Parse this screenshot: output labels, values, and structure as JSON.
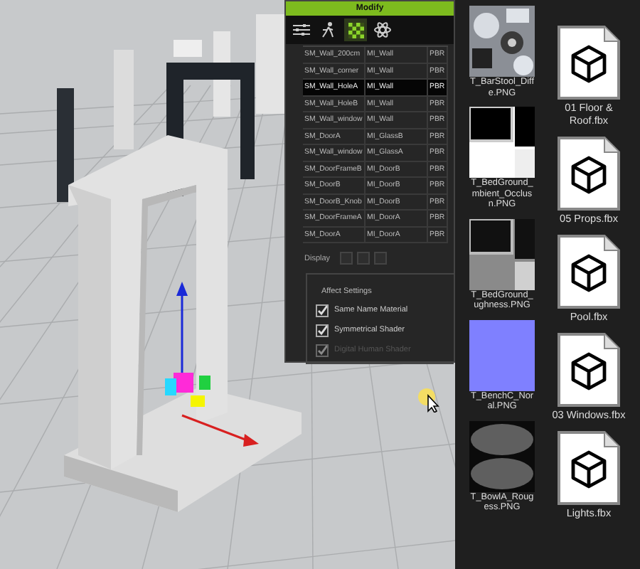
{
  "panel": {
    "title": "Modify",
    "tabs": [
      {
        "kind": "sliders",
        "selected": false
      },
      {
        "kind": "figure",
        "selected": false
      },
      {
        "kind": "checker",
        "selected": true
      },
      {
        "kind": "atom",
        "selected": false
      }
    ],
    "rows": [
      {
        "mesh": "SM_Wall_200cm",
        "material": "MI_Wall",
        "shader": "PBR",
        "selected": false
      },
      {
        "mesh": "SM_Wall_corner",
        "material": "MI_Wall",
        "shader": "PBR",
        "selected": false
      },
      {
        "mesh": "SM_Wall_HoleA",
        "material": "MI_Wall",
        "shader": "PBR",
        "selected": true
      },
      {
        "mesh": "SM_Wall_HoleB",
        "material": "MI_Wall",
        "shader": "PBR",
        "selected": false
      },
      {
        "mesh": "SM_Wall_window",
        "material": "MI_Wall",
        "shader": "PBR",
        "selected": false
      },
      {
        "mesh": "SM_DoorA",
        "material": "MI_GlassB",
        "shader": "PBR",
        "selected": false
      },
      {
        "mesh": "SM_Wall_window",
        "material": "MI_GlassA",
        "shader": "PBR",
        "selected": false
      },
      {
        "mesh": "SM_DoorFrameB",
        "material": "MI_DoorB",
        "shader": "PBR",
        "selected": false
      },
      {
        "mesh": "SM_DoorB",
        "material": "MI_DoorB",
        "shader": "PBR",
        "selected": false
      },
      {
        "mesh": "SM_DoorB_Knob",
        "material": "MI_DoorB",
        "shader": "PBR",
        "selected": false
      },
      {
        "mesh": "SM_DoorFrameA",
        "material": "MI_DoorA",
        "shader": "PBR",
        "selected": false
      },
      {
        "mesh": "SM_DoorA",
        "material": "MI_DoorA",
        "shader": "PBR",
        "selected": false
      }
    ],
    "display_label": "Display",
    "group_title": "Affect Settings",
    "options": [
      {
        "label": "Same Name Material",
        "checked": true,
        "disabled": false
      },
      {
        "label": "Symmetrical Shader",
        "checked": true,
        "disabled": false
      },
      {
        "label": "Digital Human Shader",
        "checked": true,
        "disabled": true
      }
    ]
  },
  "textures": [
    {
      "kind": "collage",
      "lines": [
        "T_BarStool_Diff",
        "e.PNG"
      ]
    },
    {
      "kind": "occlusion",
      "lines": [
        "T_BedGround_",
        "mbient_Occlus",
        "n.PNG"
      ]
    },
    {
      "kind": "roughness",
      "lines": [
        "T_BedGround_",
        "ughness.PNG"
      ]
    },
    {
      "kind": "normal",
      "lines": [
        "T_BenchC_Nor",
        "al.PNG"
      ]
    },
    {
      "kind": "ovals",
      "lines": [
        "T_BowlA_Roug",
        "ess.PNG"
      ]
    }
  ],
  "files": [
    {
      "name": "01 Floor & Roof.fbx"
    },
    {
      "name": "05 Props.fbx"
    },
    {
      "name": "Pool.fbx"
    },
    {
      "name": "03 Windows.fbx"
    },
    {
      "name": "Lights.fbx"
    }
  ]
}
